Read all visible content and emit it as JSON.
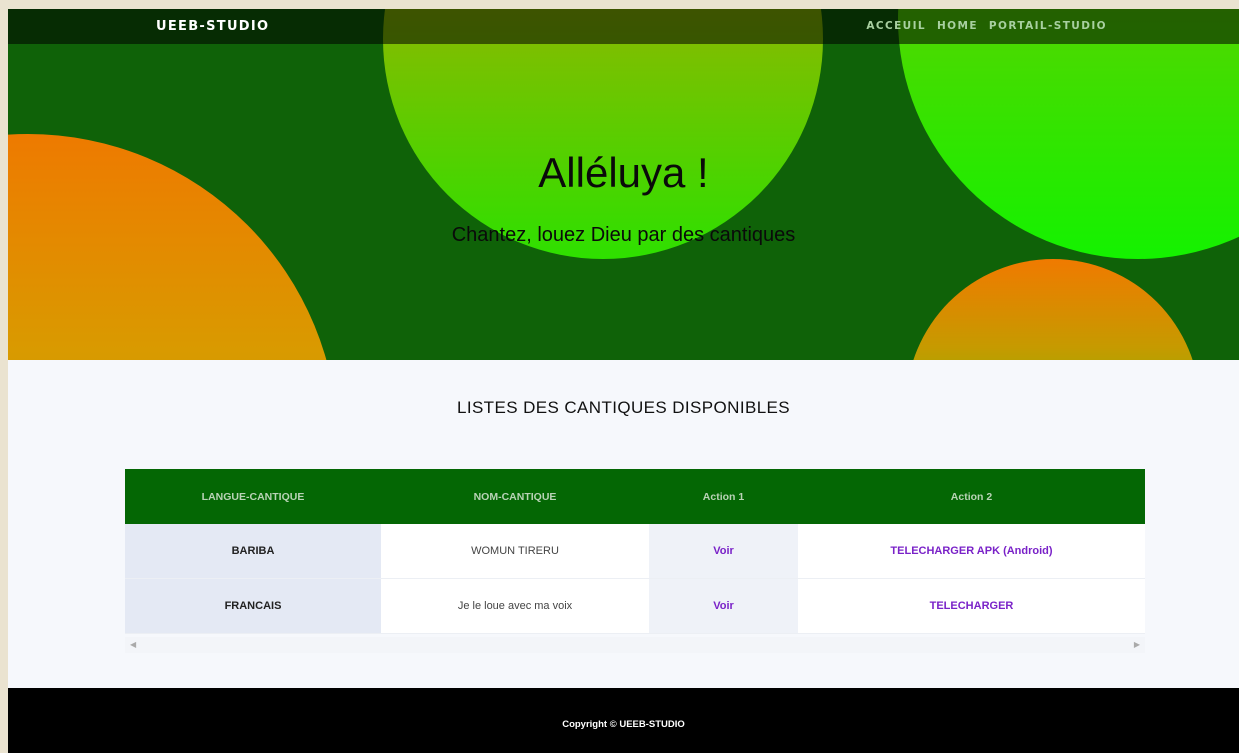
{
  "navbar": {
    "brand": "UEEB-STUDIO",
    "links": [
      "ACCEUIL",
      "HOME",
      "PORTAIL-STUDIO"
    ]
  },
  "hero": {
    "title": "Alléluya !",
    "subtitle": "Chantez, louez Dieu par des cantiques"
  },
  "section": {
    "title": "LISTES DES CANTIQUES DISPONIBLES"
  },
  "table": {
    "headers": [
      "LANGUE-CANTIQUE",
      "NOM-CANTIQUE",
      "Action 1",
      "Action 2"
    ],
    "rows": [
      {
        "langue": "BARIBA",
        "nom": "WOMUN TIRERU",
        "action1": "Voir",
        "action2": "TELECHARGER APK (Android)"
      },
      {
        "langue": "FRANCAIS",
        "nom": "Je le loue avec ma voix",
        "action1": "Voir",
        "action2": "TELECHARGER"
      }
    ]
  },
  "footer": {
    "copyright": "Copyright © UEEB-STUDIO"
  },
  "colors": {
    "hero_bg": "#0f6208",
    "table_header_bg": "#046704",
    "link_purple": "#7a22c8",
    "footer_bg": "#000000"
  }
}
